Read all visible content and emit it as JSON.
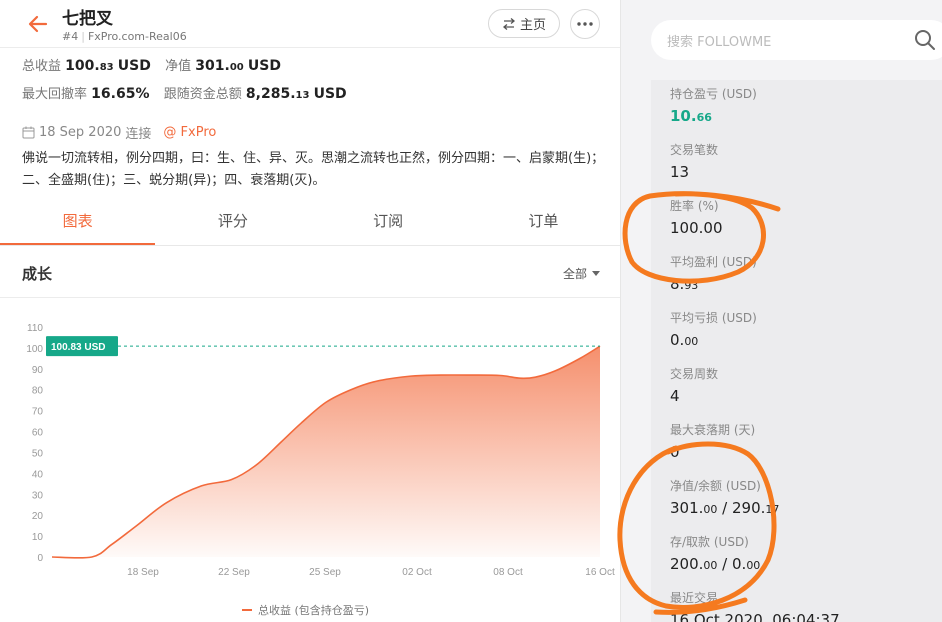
{
  "trader": {
    "name": "七把叉",
    "rank": "#4",
    "account": "FxPro.com-Real06",
    "home_label": "主页"
  },
  "stats": {
    "total_profit_label": "总收益",
    "total_profit_int": "100.",
    "total_profit_dec": "83",
    "total_profit_unit": "USD",
    "equity_label": "净值",
    "equity_int": "301.",
    "equity_dec": "00",
    "equity_unit": "USD",
    "max_drawdown_label": "最大回撤率",
    "max_drawdown": "16.65%",
    "follow_funds_label": "跟随资金总额",
    "follow_funds_int": "8,285.",
    "follow_funds_dec": "13",
    "follow_funds_unit": "USD"
  },
  "connect": {
    "date": "18 Sep 2020",
    "verb": "连接",
    "broker": "@ FxPro"
  },
  "description": "佛说一切流转相，例分四期，曰：生、住、异、灭。思潮之流转也正然，例分四期：一、启蒙期(生)；二、全盛期(住)；三、蜕分期(异)；四、衰落期(灭)。",
  "tabs": [
    "图表",
    "评分",
    "订阅",
    "订单"
  ],
  "chart_section": {
    "title": "成长",
    "range": "全部"
  },
  "chart_data": {
    "type": "area",
    "title": "成长",
    "x_ticks": [
      "18 Sep",
      "22 Sep",
      "25 Sep",
      "02 Oct",
      "08 Oct",
      "16 Oct"
    ],
    "y_ticks": [
      0,
      10,
      20,
      30,
      40,
      50,
      60,
      70,
      80,
      90,
      100,
      110
    ],
    "ylim": [
      0,
      110
    ],
    "series": [
      {
        "name": "总收益 (包含持仓盈亏)",
        "color": "#f26a3c",
        "points": [
          [
            0,
            0
          ],
          [
            0.8,
            0
          ],
          [
            1.2,
            6
          ],
          [
            1.7,
            15
          ],
          [
            2.3,
            26
          ],
          [
            3.0,
            34
          ],
          [
            3.6,
            37
          ],
          [
            4.1,
            44
          ],
          [
            4.6,
            55
          ],
          [
            5.0,
            64
          ],
          [
            5.5,
            74
          ],
          [
            6.0,
            80
          ],
          [
            6.5,
            84
          ],
          [
            7.2,
            86.5
          ],
          [
            7.8,
            87
          ],
          [
            8.4,
            87
          ],
          [
            9.0,
            86.8
          ],
          [
            9.4,
            85.5
          ],
          [
            9.7,
            86
          ],
          [
            10.1,
            89
          ],
          [
            10.6,
            95
          ],
          [
            11.0,
            100.83
          ]
        ]
      }
    ],
    "current_label": "100.83 USD",
    "current_value": 100.83,
    "grid": false
  },
  "search": {
    "placeholder": "搜索 FOLLOWME"
  },
  "metrics": [
    {
      "label": "持仓盈亏 (USD)",
      "int": "10.",
      "dec": "66",
      "style": "green"
    },
    {
      "label": "交易笔数",
      "int": "13",
      "dec": ""
    },
    {
      "label": "胜率 (%)",
      "int": "100.00",
      "dec": ""
    },
    {
      "label": "平均盈利 (USD)",
      "int": "8.",
      "dec": "93"
    },
    {
      "label": "平均亏损 (USD)",
      "int": "0.",
      "dec": "00"
    },
    {
      "label": "交易周数",
      "int": "4",
      "dec": ""
    },
    {
      "label": "最大衰落期 (天)",
      "int": "0",
      "dec": ""
    },
    {
      "label": "净值/余额 (USD)",
      "int": "301.",
      "dec": "00",
      "extra": " / 290.",
      "extra_dec": "17"
    },
    {
      "label": "存/取款 (USD)",
      "int": "200.",
      "dec": "00",
      "extra": " / 0.",
      "extra_dec": "00"
    },
    {
      "label": "最近交易",
      "int": "16 Oct 2020, 06:04:37",
      "dec": ""
    }
  ],
  "colors": {
    "accent": "#f26a3c",
    "green": "#16a889",
    "annotation": "#f57a1f"
  }
}
